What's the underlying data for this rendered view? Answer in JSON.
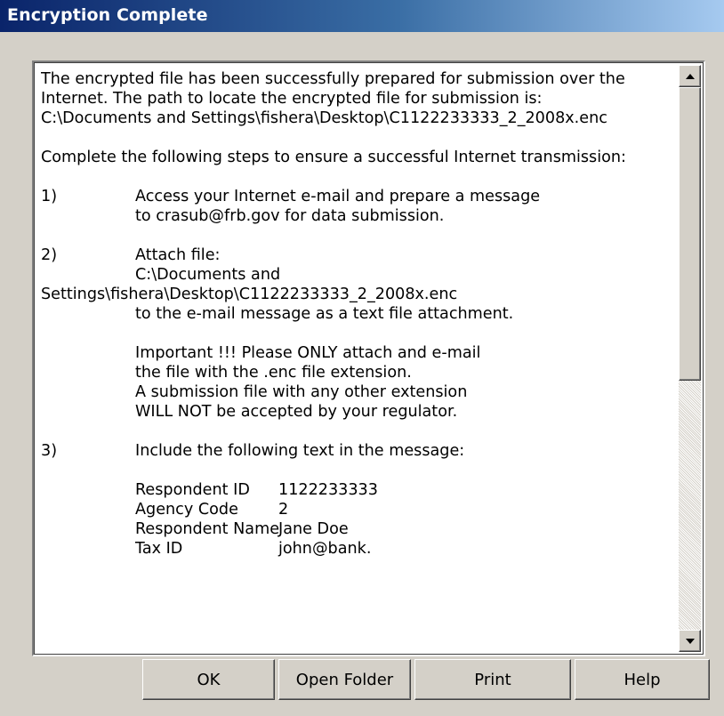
{
  "window": {
    "title": "Encryption Complete"
  },
  "message": {
    "intro": [
      "The encrypted file has been successfully prepared for submission over the",
      "Internet. The path to locate the encrypted file for submission is:",
      "C:\\Documents and Settings\\fishera\\Desktop\\C1122233333_2_2008x.enc"
    ],
    "instruction": "Complete the following steps to ensure a successful Internet transmission:",
    "step1": {
      "num": "1)",
      "line1": "Access your Internet e-mail and prepare a message",
      "line2": "to crasub@frb.gov for data submission."
    },
    "step2": {
      "num": "2)",
      "line1": "Attach file:",
      "line2": "C:\\Documents and",
      "line3": "Settings\\fishera\\Desktop\\C1122233333_2_2008x.enc",
      "line4": "to the e-mail message as a text file attachment.",
      "important": [
        "Important !!! Please ONLY attach and e-mail",
        "the file with the .enc file extension.",
        "A submission file with any other extension",
        "WILL NOT be accepted by your regulator."
      ]
    },
    "step3": {
      "num": "3)",
      "line1": "Include the following text in the message:",
      "fields": [
        {
          "label": "Respondent ID",
          "value": "1122233333"
        },
        {
          "label": "Agency Code",
          "value": "2"
        },
        {
          "label": "Respondent Name",
          "value": "Jane Doe"
        },
        {
          "label": "Tax ID",
          "value": "john@bank."
        }
      ]
    }
  },
  "buttons": {
    "ok": "OK",
    "open_folder": "Open Folder",
    "print": "Print",
    "help": "Help"
  }
}
